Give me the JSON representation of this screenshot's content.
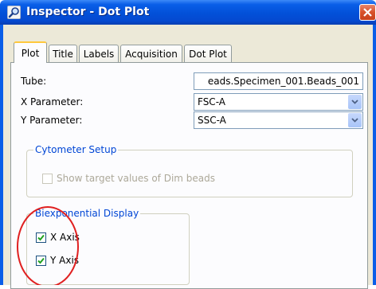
{
  "window": {
    "title": "Inspector - Dot Plot"
  },
  "tabs": [
    {
      "label": "Plot",
      "active": true
    },
    {
      "label": "Title",
      "active": false
    },
    {
      "label": "Labels",
      "active": false
    },
    {
      "label": "Acquisition",
      "active": false
    },
    {
      "label": "Dot Plot",
      "active": false
    }
  ],
  "plot": {
    "tube_label": "Tube:",
    "tube_value": "eads.Specimen_001.Beads_001",
    "x_param_label": "X Parameter:",
    "x_param_value": "FSC-A",
    "y_param_label": "Y Parameter:",
    "y_param_value": "SSC-A"
  },
  "cytometer_setup": {
    "legend": "Cytometer Setup",
    "show_target_label": "Show target values of Dim beads",
    "show_target_checked": false
  },
  "biexponential": {
    "legend": "Biexponential Display",
    "x_axis_label": "X Axis",
    "x_axis_checked": true,
    "y_axis_label": "Y Axis",
    "y_axis_checked": true
  },
  "colors": {
    "titlebar": "#0a5ee8",
    "legend_text": "#0046d5",
    "annotation": "#e02020",
    "checkmark": "#21a121"
  }
}
